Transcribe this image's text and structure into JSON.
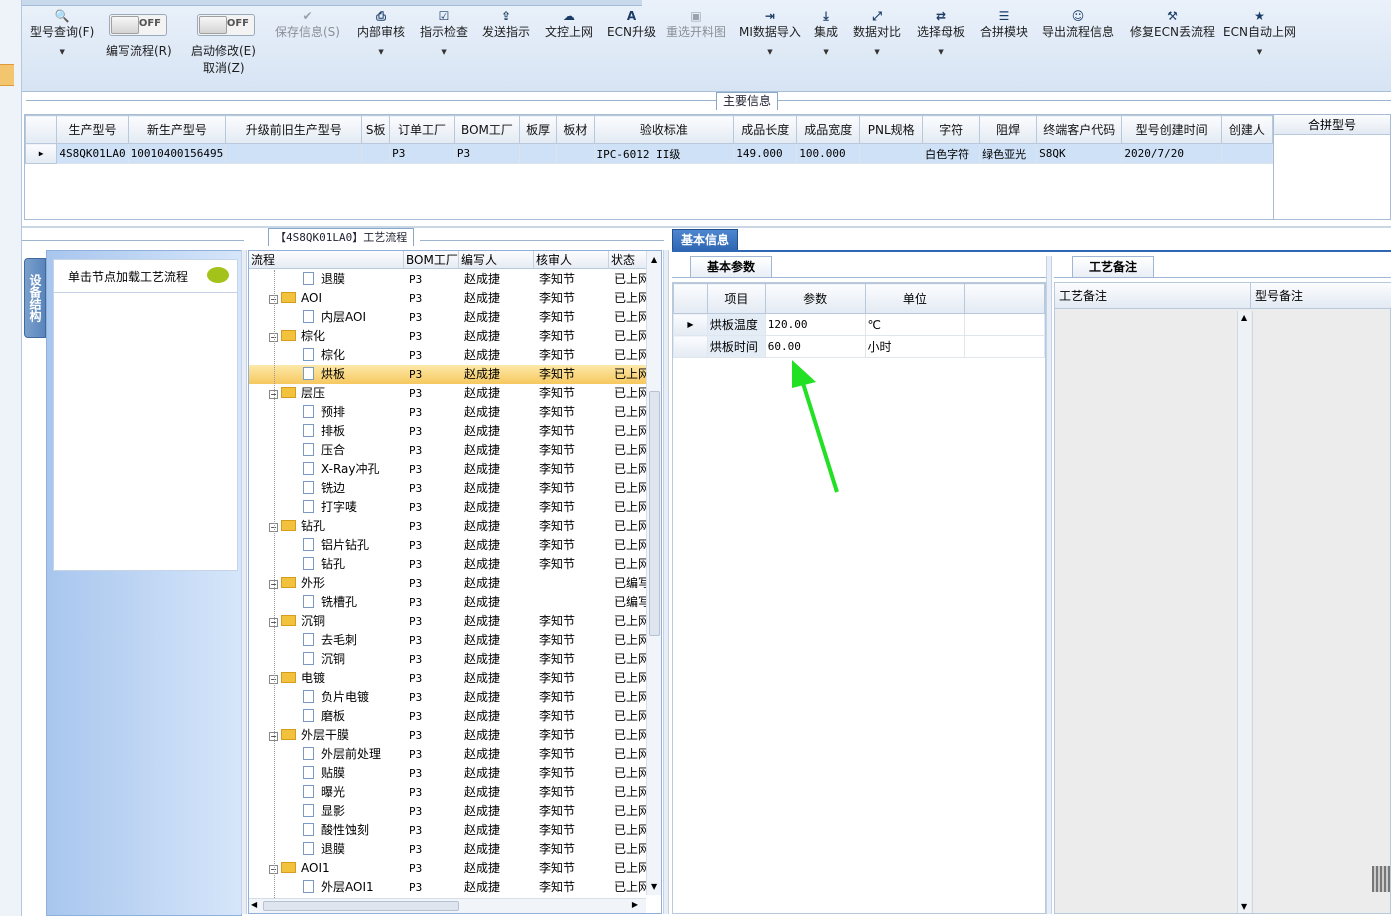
{
  "toolbar": {
    "buttons": [
      {
        "icon": "search-icon",
        "label": "型号查询(F)",
        "dropdown": true,
        "enabled": true
      },
      {
        "icon": "check-icon",
        "label": "保存信息(S)",
        "dropdown": false,
        "enabled": false
      },
      {
        "icon": "print-icon",
        "label": "内部审核",
        "dropdown": true,
        "enabled": true
      },
      {
        "icon": "checkbox-icon",
        "label": "指示检查",
        "dropdown": true,
        "enabled": true
      },
      {
        "icon": "upload-icon",
        "label": "发送指示",
        "dropdown": false,
        "enabled": true
      },
      {
        "icon": "cloud-upload-icon",
        "label": "文控上网",
        "dropdown": false,
        "enabled": true
      },
      {
        "icon": "ecn-icon",
        "label": "ECN升级",
        "dropdown": false,
        "enabled": true
      },
      {
        "icon": "image-icon",
        "label": "重选开料图",
        "dropdown": false,
        "enabled": false
      },
      {
        "icon": "import-icon",
        "label": "MI数据导入",
        "dropdown": true,
        "enabled": true
      },
      {
        "icon": "download-icon",
        "label": "集成",
        "dropdown": true,
        "enabled": true
      },
      {
        "icon": "compare-icon",
        "label": "数据对比",
        "dropdown": true,
        "enabled": true
      },
      {
        "icon": "shuffle-icon",
        "label": "选择母板",
        "dropdown": true,
        "enabled": true
      },
      {
        "icon": "list-icon",
        "label": "合拼模块",
        "dropdown": false,
        "enabled": true
      },
      {
        "icon": "smile-icon",
        "label": "导出流程信息",
        "dropdown": false,
        "enabled": true
      },
      {
        "icon": "wrench-icon",
        "label": "修复ECN丢流程",
        "dropdown": false,
        "enabled": true
      },
      {
        "icon": "star-icon",
        "label": "ECN自动上网",
        "dropdown": true,
        "enabled": true
      }
    ],
    "toggles": [
      {
        "state": "OFF",
        "label": "编写流程(R)"
      },
      {
        "state": "OFF",
        "label": "启动修改(E)",
        "sublabel": "取消(Z)"
      }
    ]
  },
  "main_info": {
    "title": "主要信息",
    "columns": [
      "生产型号",
      "新生产型号",
      "升级前旧生产型号",
      "S板",
      "订单工厂",
      "BOM工厂",
      "板厚",
      "板材",
      "验收标准",
      "成品长度",
      "成品宽度",
      "PNL规格",
      "字符",
      "阻焊",
      "终端客户代码",
      "型号创建时间",
      "创建人"
    ],
    "rows": [
      [
        "4S8QK01LA0",
        "10010400156495",
        "",
        "",
        "P3",
        "P3",
        "",
        "",
        "IPC-6012 II级",
        "149.000",
        "100.000",
        "",
        "白色字符",
        "绿色亚光",
        "S8QK",
        "2020/7/20",
        ""
      ]
    ],
    "side_header": "合拼型号"
  },
  "flow": {
    "title": "【4S8QK01LA0】工艺流程",
    "vertical_tab": "设备结构",
    "hint": "单击节点加载工艺流程",
    "columns": [
      "流程",
      "BOM工厂",
      "编写人",
      "核审人",
      "状态"
    ],
    "rows": [
      {
        "name": "退膜",
        "level": 2,
        "factory": "P3",
        "writer": "赵成捷",
        "reviewer": "李知节",
        "status": "已上网"
      },
      {
        "name": "AOI",
        "level": 1,
        "factory": "P3",
        "writer": "赵成捷",
        "reviewer": "李知节",
        "status": "已上网"
      },
      {
        "name": "内层AOI",
        "level": 2,
        "factory": "P3",
        "writer": "赵成捷",
        "reviewer": "李知节",
        "status": "已上网"
      },
      {
        "name": "棕化",
        "level": 1,
        "factory": "P3",
        "writer": "赵成捷",
        "reviewer": "李知节",
        "status": "已上网"
      },
      {
        "name": "棕化",
        "level": 2,
        "factory": "P3",
        "writer": "赵成捷",
        "reviewer": "李知节",
        "status": "已上网"
      },
      {
        "name": "烘板",
        "level": 2,
        "factory": "P3",
        "writer": "赵成捷",
        "reviewer": "李知节",
        "status": "已上网",
        "selected": true
      },
      {
        "name": "层压",
        "level": 1,
        "factory": "P3",
        "writer": "赵成捷",
        "reviewer": "李知节",
        "status": "已上网"
      },
      {
        "name": "预排",
        "level": 2,
        "factory": "P3",
        "writer": "赵成捷",
        "reviewer": "李知节",
        "status": "已上网"
      },
      {
        "name": "排板",
        "level": 2,
        "factory": "P3",
        "writer": "赵成捷",
        "reviewer": "李知节",
        "status": "已上网"
      },
      {
        "name": "压合",
        "level": 2,
        "factory": "P3",
        "writer": "赵成捷",
        "reviewer": "李知节",
        "status": "已上网"
      },
      {
        "name": "X-Ray冲孔",
        "level": 2,
        "factory": "P3",
        "writer": "赵成捷",
        "reviewer": "李知节",
        "status": "已上网"
      },
      {
        "name": "铣边",
        "level": 2,
        "factory": "P3",
        "writer": "赵成捷",
        "reviewer": "李知节",
        "status": "已上网"
      },
      {
        "name": "打字唛",
        "level": 2,
        "factory": "P3",
        "writer": "赵成捷",
        "reviewer": "李知节",
        "status": "已上网"
      },
      {
        "name": "钻孔",
        "level": 1,
        "factory": "P3",
        "writer": "赵成捷",
        "reviewer": "李知节",
        "status": "已上网"
      },
      {
        "name": "铝片钻孔",
        "level": 2,
        "factory": "P3",
        "writer": "赵成捷",
        "reviewer": "李知节",
        "status": "已上网"
      },
      {
        "name": "钻孔",
        "level": 2,
        "factory": "P3",
        "writer": "赵成捷",
        "reviewer": "李知节",
        "status": "已上网"
      },
      {
        "name": "外形",
        "level": 1,
        "factory": "P3",
        "writer": "赵成捷",
        "reviewer": "",
        "status": "已编写"
      },
      {
        "name": "铣槽孔",
        "level": 2,
        "factory": "P3",
        "writer": "赵成捷",
        "reviewer": "",
        "status": "已编写"
      },
      {
        "name": "沉铜",
        "level": 1,
        "factory": "P3",
        "writer": "赵成捷",
        "reviewer": "李知节",
        "status": "已上网"
      },
      {
        "name": "去毛刺",
        "level": 2,
        "factory": "P3",
        "writer": "赵成捷",
        "reviewer": "李知节",
        "status": "已上网"
      },
      {
        "name": "沉铜",
        "level": 2,
        "factory": "P3",
        "writer": "赵成捷",
        "reviewer": "李知节",
        "status": "已上网"
      },
      {
        "name": "电镀",
        "level": 1,
        "factory": "P3",
        "writer": "赵成捷",
        "reviewer": "李知节",
        "status": "已上网"
      },
      {
        "name": "负片电镀",
        "level": 2,
        "factory": "P3",
        "writer": "赵成捷",
        "reviewer": "李知节",
        "status": "已上网"
      },
      {
        "name": "磨板",
        "level": 2,
        "factory": "P3",
        "writer": "赵成捷",
        "reviewer": "李知节",
        "status": "已上网"
      },
      {
        "name": "外层干膜",
        "level": 1,
        "factory": "P3",
        "writer": "赵成捷",
        "reviewer": "李知节",
        "status": "已上网"
      },
      {
        "name": "外层前处理",
        "level": 2,
        "factory": "P3",
        "writer": "赵成捷",
        "reviewer": "李知节",
        "status": "已上网"
      },
      {
        "name": "贴膜",
        "level": 2,
        "factory": "P3",
        "writer": "赵成捷",
        "reviewer": "李知节",
        "status": "已上网"
      },
      {
        "name": "曝光",
        "level": 2,
        "factory": "P3",
        "writer": "赵成捷",
        "reviewer": "李知节",
        "status": "已上网"
      },
      {
        "name": "显影",
        "level": 2,
        "factory": "P3",
        "writer": "赵成捷",
        "reviewer": "李知节",
        "status": "已上网"
      },
      {
        "name": "酸性蚀刻",
        "level": 2,
        "factory": "P3",
        "writer": "赵成捷",
        "reviewer": "李知节",
        "status": "已上网"
      },
      {
        "name": "退膜",
        "level": 2,
        "factory": "P3",
        "writer": "赵成捷",
        "reviewer": "李知节",
        "status": "已上网"
      },
      {
        "name": "AOI1",
        "level": 1,
        "factory": "P3",
        "writer": "赵成捷",
        "reviewer": "李知节",
        "status": "已上网"
      },
      {
        "name": "外层AOI1",
        "level": 2,
        "factory": "P3",
        "writer": "赵成捷",
        "reviewer": "李知节",
        "status": "已上网"
      }
    ]
  },
  "basic_info": {
    "tab": "基本信息",
    "params_tab": "基本参数",
    "columns": [
      "项目",
      "参数",
      "单位"
    ],
    "rows": [
      {
        "item": "烘板温度",
        "value": "120.00",
        "unit": "℃"
      },
      {
        "item": "烘板时间",
        "value": "60.00",
        "unit": "小时"
      }
    ]
  },
  "remarks": {
    "tab": "工艺备注",
    "col1": "工艺备注",
    "col2": "型号备注"
  },
  "colors": {
    "accent": "#2f67b4",
    "selected_row": "#f6c85e",
    "annotation_arrow": "#22e023"
  }
}
